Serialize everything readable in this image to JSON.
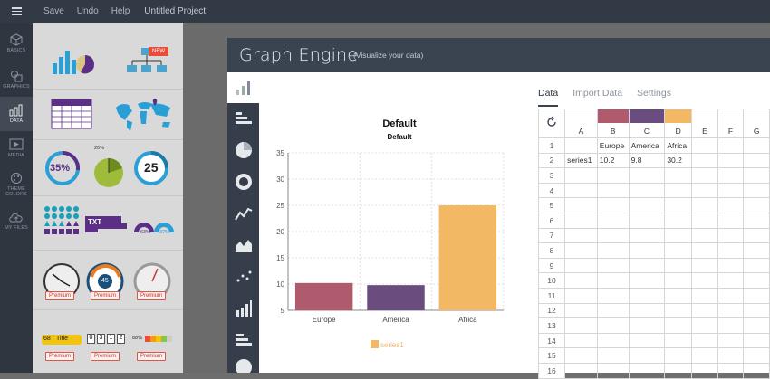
{
  "menu": {
    "save": "Save",
    "undo": "Undo",
    "help": "Help",
    "project": "Untitled Project"
  },
  "rail": [
    {
      "label": "BASICS"
    },
    {
      "label": "GRAPHICS"
    },
    {
      "label": "DATA"
    },
    {
      "label": "MEDIA"
    },
    {
      "label": "THEME COLORS"
    },
    {
      "label": "MY FILES"
    }
  ],
  "library": {
    "new_badge": "NEW",
    "percent_35": "35%",
    "percent_20": "20%",
    "number_25": "25",
    "txt": "TXT",
    "percent_63": "63%",
    "percent_37": "37%",
    "gauge_45": "45",
    "premium": "Premium",
    "counter_68": "68",
    "title_word": "Title",
    "digits": [
      "0",
      "3",
      "1",
      "2"
    ],
    "percent_88": "88%"
  },
  "modal": {
    "title": "Graph Engine",
    "subtitle": "(Visualize your data)"
  },
  "tabs": {
    "data": "Data",
    "import": "Import Data",
    "settings": "Settings"
  },
  "colors": {
    "europe": "#b05a6e",
    "america": "#6a4c7e",
    "africa": "#f3b863",
    "header_bar": "#3a4350"
  },
  "chart_data": {
    "type": "bar",
    "title": "Default",
    "subtitle": "Default",
    "categories": [
      "Europe",
      "America",
      "Africa"
    ],
    "series": [
      {
        "name": "series1",
        "values": [
          10.2,
          9.8,
          25
        ]
      }
    ],
    "ylim": [
      5,
      35
    ],
    "yticks": [
      5,
      10,
      15,
      20,
      25,
      30,
      35
    ],
    "grid": true,
    "legend": "bottom-center"
  },
  "sheet": {
    "columns": [
      "A",
      "B",
      "C",
      "D",
      "E",
      "F",
      "G"
    ],
    "rows": [
      [
        "",
        "Europe",
        "America",
        "Africa",
        "",
        "",
        ""
      ],
      [
        "series1",
        "10.2",
        "9.8",
        "30.2",
        "",
        "",
        ""
      ],
      [
        "",
        "",
        "",
        "",
        "",
        "",
        ""
      ],
      [
        "",
        "",
        "",
        "",
        "",
        "",
        ""
      ],
      [
        "",
        "",
        "",
        "",
        "",
        "",
        ""
      ],
      [
        "",
        "",
        "",
        "",
        "",
        "",
        ""
      ],
      [
        "",
        "",
        "",
        "",
        "",
        "",
        ""
      ],
      [
        "",
        "",
        "",
        "",
        "",
        "",
        ""
      ],
      [
        "",
        "",
        "",
        "",
        "",
        "",
        ""
      ],
      [
        "",
        "",
        "",
        "",
        "",
        "",
        ""
      ],
      [
        "",
        "",
        "",
        "",
        "",
        "",
        ""
      ],
      [
        "",
        "",
        "",
        "",
        "",
        "",
        ""
      ],
      [
        "",
        "",
        "",
        "",
        "",
        "",
        ""
      ],
      [
        "",
        "",
        "",
        "",
        "",
        "",
        ""
      ],
      [
        "",
        "",
        "",
        "",
        "",
        "",
        ""
      ],
      [
        "",
        "",
        "",
        "",
        "",
        "",
        ""
      ]
    ],
    "row_numbers": [
      "1",
      "2",
      "3",
      "4",
      "5",
      "6",
      "7",
      "8",
      "9",
      "10",
      "11",
      "12",
      "13",
      "14",
      "15",
      "16"
    ]
  }
}
